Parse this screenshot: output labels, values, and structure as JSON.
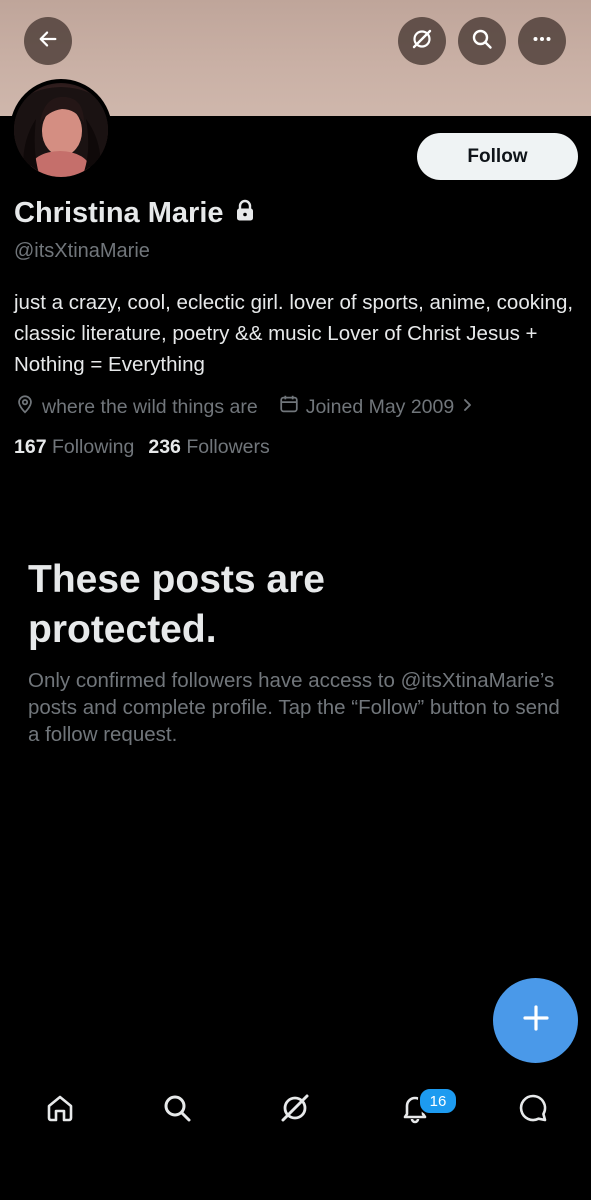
{
  "header": {
    "banner_color": "#c9b0a5",
    "icons": [
      "arrow-left-icon",
      "grok-icon",
      "search-icon",
      "more-dots-icon"
    ]
  },
  "profile": {
    "display_name": "Christina Marie",
    "handle": "@itsXtinaMarie",
    "follow_label": "Follow",
    "bio": "just a crazy, cool, eclectic girl. lover of sports, anime, cooking, classic literature, poetry && music Lover of Christ Jesus + Nothing = Everything",
    "location": "where the wild things are",
    "joined": "Joined May 2009",
    "following_count": "167",
    "following_label": "Following",
    "followers_count": "236",
    "followers_label": "Followers"
  },
  "protected": {
    "title": "These posts are protected.",
    "description": "Only confirmed followers have access to @itsXtinaMarie’s posts and complete profile. Tap the “Follow” button to send a follow request."
  },
  "nav": {
    "items": [
      "home-icon",
      "search-icon",
      "grok-icon",
      "notifications-icon",
      "messages-icon"
    ],
    "notification_badge": "16"
  },
  "colors": {
    "background": "#000000",
    "accent": "#1d9bf0",
    "fab": "#4a99e9",
    "muted_text": "#71767b",
    "primary_text": "#e7e9ea"
  }
}
